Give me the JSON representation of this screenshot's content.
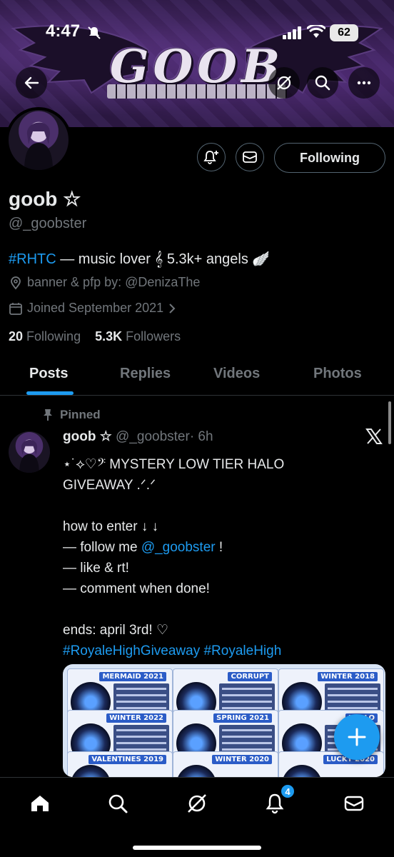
{
  "status": {
    "time": "4:47",
    "battery": "62"
  },
  "banner": {
    "wordmark": "GOOB"
  },
  "profile": {
    "name": "goob ☆",
    "handle": "@_goobster",
    "follow_label": "Following",
    "bio_hashtag": "#RHTC",
    "bio_text": " — music lover 𝄞 5.3k+ angels 🪽",
    "location_text": "banner & pfp by: @DenizaThe",
    "joined_text": "Joined September 2021",
    "following_count": "20",
    "following_label": "Following",
    "followers_count": "5.3K",
    "followers_label": "Followers"
  },
  "tabs": [
    "Posts",
    "Replies",
    "Videos",
    "Photos"
  ],
  "post": {
    "pinned_label": "Pinned",
    "author_name": "goob ☆",
    "author_handle": "@_goobster",
    "time": "· 6h",
    "line1": "⋆˙⟡♡𝄢 MYSTERY LOW TIER HALO",
    "line2": "GIVEAWAY .ᐟ.ᐟ",
    "line3": "how to enter ↓ ↓",
    "line4_prefix": "— follow me ",
    "line4_link": "@_goobster",
    "line4_suffix": " !",
    "line5": "— like & rt!",
    "line6": "— comment when done!",
    "line7": "ends: april 3rd! ♡",
    "hashtags": "#RoyaleHighGiveaway #RoyaleHigh",
    "media_cells": [
      "MERMAID 2021",
      "CORRUPT",
      "WINTER 2018",
      "WINTER 2022",
      "SPRING 2021",
      "HALLO",
      "VALENTINES 2019",
      "WINTER 2020",
      "LUCKY 2020"
    ]
  },
  "nav": {
    "notifications_badge": "4"
  }
}
